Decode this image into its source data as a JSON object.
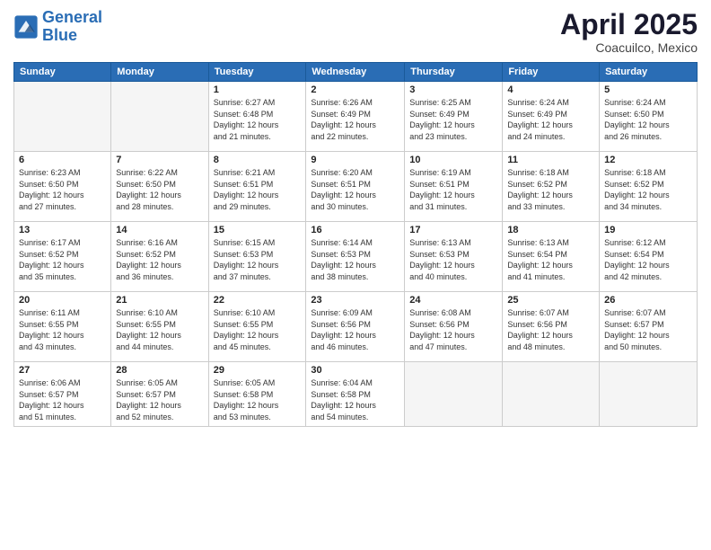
{
  "logo": {
    "line1": "General",
    "line2": "Blue"
  },
  "title": "April 2025",
  "location": "Coacuilco, Mexico",
  "days_of_week": [
    "Sunday",
    "Monday",
    "Tuesday",
    "Wednesday",
    "Thursday",
    "Friday",
    "Saturday"
  ],
  "weeks": [
    [
      {
        "day": "",
        "info": ""
      },
      {
        "day": "",
        "info": ""
      },
      {
        "day": "1",
        "info": "Sunrise: 6:27 AM\nSunset: 6:48 PM\nDaylight: 12 hours\nand 21 minutes."
      },
      {
        "day": "2",
        "info": "Sunrise: 6:26 AM\nSunset: 6:49 PM\nDaylight: 12 hours\nand 22 minutes."
      },
      {
        "day": "3",
        "info": "Sunrise: 6:25 AM\nSunset: 6:49 PM\nDaylight: 12 hours\nand 23 minutes."
      },
      {
        "day": "4",
        "info": "Sunrise: 6:24 AM\nSunset: 6:49 PM\nDaylight: 12 hours\nand 24 minutes."
      },
      {
        "day": "5",
        "info": "Sunrise: 6:24 AM\nSunset: 6:50 PM\nDaylight: 12 hours\nand 26 minutes."
      }
    ],
    [
      {
        "day": "6",
        "info": "Sunrise: 6:23 AM\nSunset: 6:50 PM\nDaylight: 12 hours\nand 27 minutes."
      },
      {
        "day": "7",
        "info": "Sunrise: 6:22 AM\nSunset: 6:50 PM\nDaylight: 12 hours\nand 28 minutes."
      },
      {
        "day": "8",
        "info": "Sunrise: 6:21 AM\nSunset: 6:51 PM\nDaylight: 12 hours\nand 29 minutes."
      },
      {
        "day": "9",
        "info": "Sunrise: 6:20 AM\nSunset: 6:51 PM\nDaylight: 12 hours\nand 30 minutes."
      },
      {
        "day": "10",
        "info": "Sunrise: 6:19 AM\nSunset: 6:51 PM\nDaylight: 12 hours\nand 31 minutes."
      },
      {
        "day": "11",
        "info": "Sunrise: 6:18 AM\nSunset: 6:52 PM\nDaylight: 12 hours\nand 33 minutes."
      },
      {
        "day": "12",
        "info": "Sunrise: 6:18 AM\nSunset: 6:52 PM\nDaylight: 12 hours\nand 34 minutes."
      }
    ],
    [
      {
        "day": "13",
        "info": "Sunrise: 6:17 AM\nSunset: 6:52 PM\nDaylight: 12 hours\nand 35 minutes."
      },
      {
        "day": "14",
        "info": "Sunrise: 6:16 AM\nSunset: 6:52 PM\nDaylight: 12 hours\nand 36 minutes."
      },
      {
        "day": "15",
        "info": "Sunrise: 6:15 AM\nSunset: 6:53 PM\nDaylight: 12 hours\nand 37 minutes."
      },
      {
        "day": "16",
        "info": "Sunrise: 6:14 AM\nSunset: 6:53 PM\nDaylight: 12 hours\nand 38 minutes."
      },
      {
        "day": "17",
        "info": "Sunrise: 6:13 AM\nSunset: 6:53 PM\nDaylight: 12 hours\nand 40 minutes."
      },
      {
        "day": "18",
        "info": "Sunrise: 6:13 AM\nSunset: 6:54 PM\nDaylight: 12 hours\nand 41 minutes."
      },
      {
        "day": "19",
        "info": "Sunrise: 6:12 AM\nSunset: 6:54 PM\nDaylight: 12 hours\nand 42 minutes."
      }
    ],
    [
      {
        "day": "20",
        "info": "Sunrise: 6:11 AM\nSunset: 6:55 PM\nDaylight: 12 hours\nand 43 minutes."
      },
      {
        "day": "21",
        "info": "Sunrise: 6:10 AM\nSunset: 6:55 PM\nDaylight: 12 hours\nand 44 minutes."
      },
      {
        "day": "22",
        "info": "Sunrise: 6:10 AM\nSunset: 6:55 PM\nDaylight: 12 hours\nand 45 minutes."
      },
      {
        "day": "23",
        "info": "Sunrise: 6:09 AM\nSunset: 6:56 PM\nDaylight: 12 hours\nand 46 minutes."
      },
      {
        "day": "24",
        "info": "Sunrise: 6:08 AM\nSunset: 6:56 PM\nDaylight: 12 hours\nand 47 minutes."
      },
      {
        "day": "25",
        "info": "Sunrise: 6:07 AM\nSunset: 6:56 PM\nDaylight: 12 hours\nand 48 minutes."
      },
      {
        "day": "26",
        "info": "Sunrise: 6:07 AM\nSunset: 6:57 PM\nDaylight: 12 hours\nand 50 minutes."
      }
    ],
    [
      {
        "day": "27",
        "info": "Sunrise: 6:06 AM\nSunset: 6:57 PM\nDaylight: 12 hours\nand 51 minutes."
      },
      {
        "day": "28",
        "info": "Sunrise: 6:05 AM\nSunset: 6:57 PM\nDaylight: 12 hours\nand 52 minutes."
      },
      {
        "day": "29",
        "info": "Sunrise: 6:05 AM\nSunset: 6:58 PM\nDaylight: 12 hours\nand 53 minutes."
      },
      {
        "day": "30",
        "info": "Sunrise: 6:04 AM\nSunset: 6:58 PM\nDaylight: 12 hours\nand 54 minutes."
      },
      {
        "day": "",
        "info": ""
      },
      {
        "day": "",
        "info": ""
      },
      {
        "day": "",
        "info": ""
      }
    ]
  ]
}
